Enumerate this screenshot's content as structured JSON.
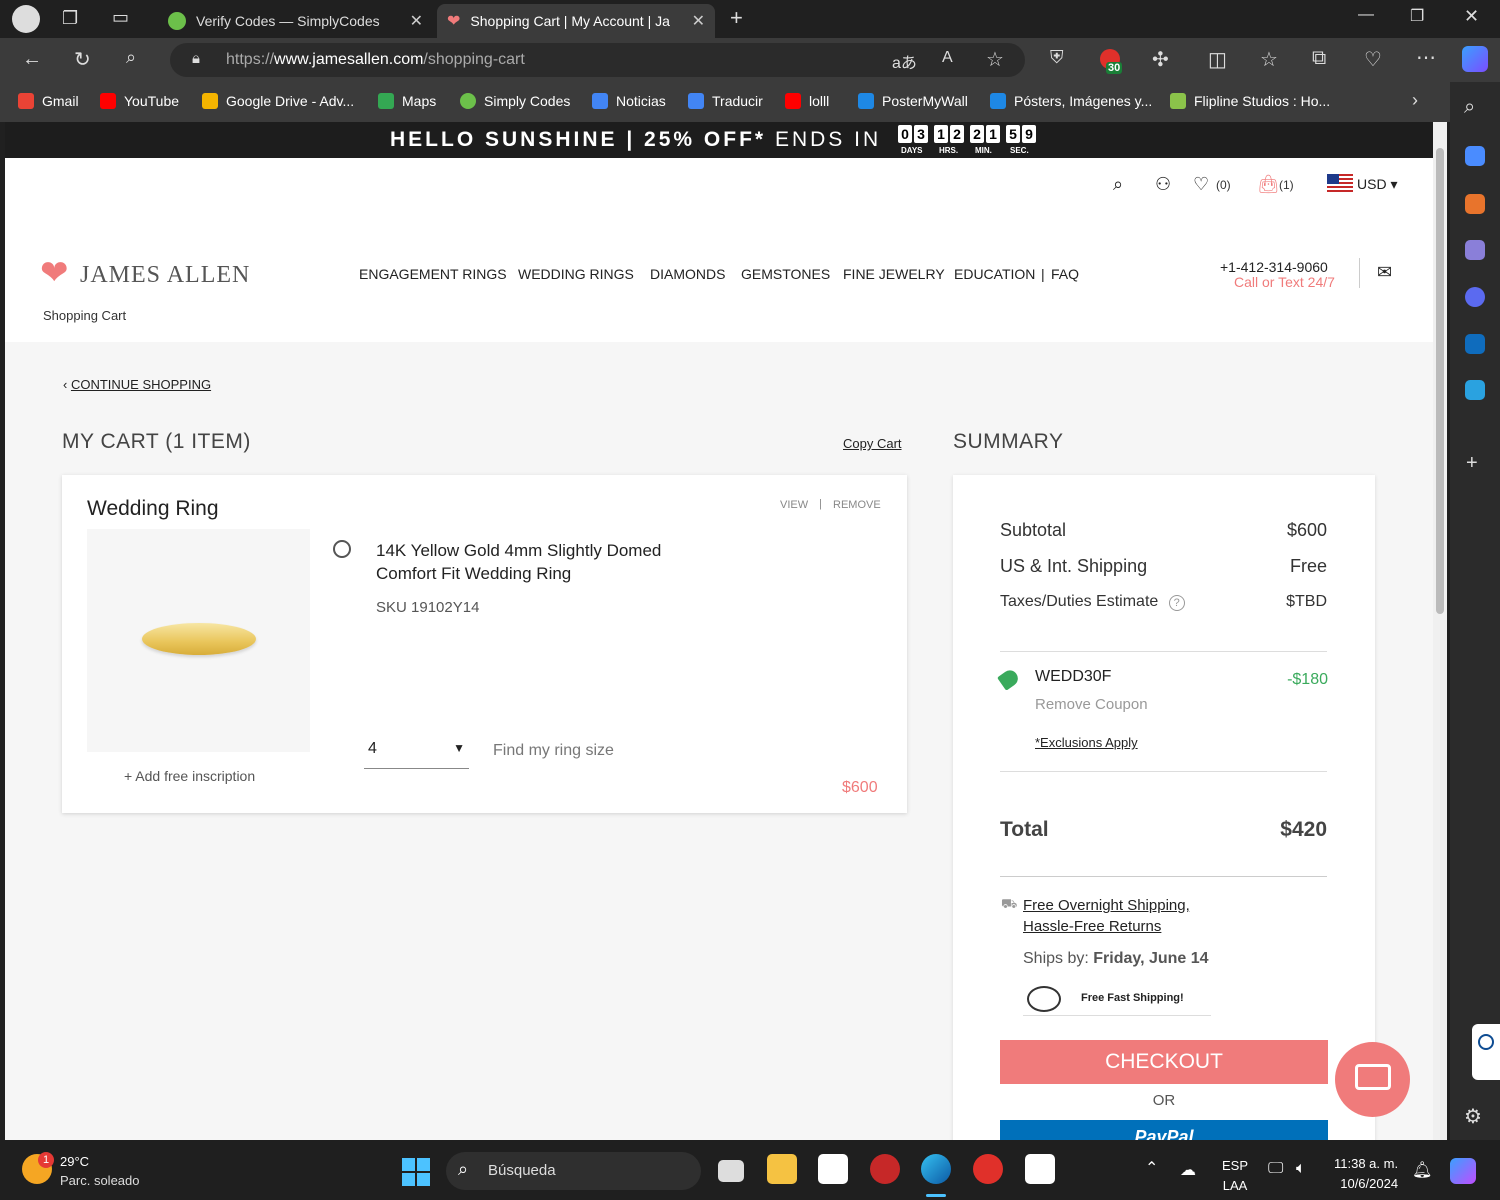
{
  "browser": {
    "tabs": [
      {
        "title": "Verify Codes — SimplyCodes",
        "active": false
      },
      {
        "title": "Shopping Cart | My Account | Jar",
        "active": true
      }
    ],
    "url_prefix": "https://",
    "url_domain": "www.jamesallen.com",
    "url_path": "/shopping-cart",
    "extension_badge": "30",
    "bookmarks": [
      "Gmail",
      "YouTube",
      "Google Drive - Adv...",
      "Maps",
      "Simply Codes",
      "Noticias",
      "Traducir",
      "lolll",
      "PosterMyWall",
      "Pósters, Imágenes y...",
      "Flipline Studios : Ho..."
    ]
  },
  "promo": {
    "text_bold": "HELLO SUNSHINE | 25% OFF*",
    "text_light": "ENDS IN",
    "countdown_digits": [
      "0",
      "3",
      "1",
      "2",
      "2",
      "1",
      "5",
      "9"
    ],
    "countdown_labels": [
      "DAYS",
      "HRS.",
      "MIN.",
      "SEC."
    ]
  },
  "header": {
    "wishlist_count": "(0)",
    "cart_count": "(1)",
    "currency": "USD",
    "logo": "JAMES ALLEN",
    "nav": [
      "ENGAGEMENT RINGS",
      "WEDDING RINGS",
      "DIAMONDS",
      "GEMSTONES",
      "FINE JEWELRY",
      "EDUCATION",
      "FAQ"
    ],
    "phone": "+1-412-314-9060",
    "phone_sub": "Call or Text 24/7"
  },
  "breadcrumb": "Shopping Cart",
  "cart": {
    "continue": "CONTINUE SHOPPING",
    "title": "MY CART (1 ITEM)",
    "copy_cart": "Copy Cart",
    "item": {
      "category": "Wedding Ring",
      "view": "VIEW",
      "remove": "REMOVE",
      "name_line1": "14K Yellow Gold 4mm Slightly Domed",
      "name_line2": "Comfort Fit Wedding Ring",
      "sku": "SKU 19102Y14",
      "size": "4",
      "find_size": "Find my ring size",
      "inscription": "+ Add free inscription",
      "price": "$600"
    }
  },
  "summary": {
    "title": "SUMMARY",
    "subtotal_label": "Subtotal",
    "subtotal": "$600",
    "shipping_label": "US & Int. Shipping",
    "shipping": "Free",
    "taxes_label": "Taxes/Duties Estimate",
    "taxes": "$TBD",
    "coupon_code": "WEDD30F",
    "coupon_amount": "-$180",
    "remove_coupon": "Remove Coupon",
    "exclusions": "*Exclusions Apply",
    "total_label": "Total",
    "total": "$420",
    "ship_link1": "Free Overnight Shipping,",
    "ship_link2": "Hassle-Free Returns",
    "ships_by_label": "Ships by: ",
    "ships_by_date": "Friday, June 14",
    "fast_shipping": "Free Fast Shipping!",
    "checkout": "CHECKOUT",
    "or": "OR",
    "paypal": "PayPal"
  },
  "taskbar": {
    "weather_temp": "29°C",
    "weather_desc": "Parc. soleado",
    "weather_badge": "1",
    "search": "Búsqueda",
    "lang1": "ESP",
    "lang2": "LAA",
    "time": "11:38 a. m.",
    "date": "10/6/2024"
  },
  "colors": {
    "accent": "#f07b7b",
    "coupon_green": "#3aaa5c",
    "paypal_blue": "#0070ba"
  }
}
